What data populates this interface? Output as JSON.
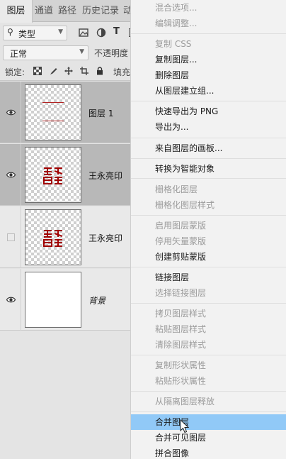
{
  "tabs": {
    "layers": "图层",
    "channels": "通道",
    "paths": "路径",
    "history": "历史记录",
    "more": "动"
  },
  "filter": {
    "kind_label": "类型"
  },
  "blend": {
    "mode": "正常",
    "opacity_label": "不透明度"
  },
  "lock": {
    "label": "锁定:",
    "fill_label": "填充"
  },
  "layers": [
    {
      "name": "图层 1",
      "visible": true,
      "selected": true
    },
    {
      "name": "王永亮印",
      "visible": true,
      "selected": true
    },
    {
      "name": "王永亮印",
      "visible": false,
      "selected": false
    },
    {
      "name": "背景",
      "visible": true,
      "selected": false
    }
  ],
  "menu": {
    "items": [
      {
        "label": "混合选项...",
        "enabled": false
      },
      {
        "label": "编辑调整...",
        "enabled": false
      },
      {
        "label": "复制 CSS",
        "enabled": false
      },
      {
        "label": "复制图层...",
        "enabled": true
      },
      {
        "label": "删除图层",
        "enabled": true
      },
      {
        "label": "从图层建立组...",
        "enabled": true
      },
      {
        "label": "快速导出为 PNG",
        "enabled": true
      },
      {
        "label": "导出为...",
        "enabled": true
      },
      {
        "label": "来自图层的画板...",
        "enabled": true
      },
      {
        "label": "转换为智能对象",
        "enabled": true
      },
      {
        "label": "栅格化图层",
        "enabled": false
      },
      {
        "label": "栅格化图层样式",
        "enabled": false
      },
      {
        "label": "启用图层蒙版",
        "enabled": false
      },
      {
        "label": "停用矢量蒙版",
        "enabled": false
      },
      {
        "label": "创建剪贴蒙版",
        "enabled": true
      },
      {
        "label": "链接图层",
        "enabled": true
      },
      {
        "label": "选择链接图层",
        "enabled": false
      },
      {
        "label": "拷贝图层样式",
        "enabled": false
      },
      {
        "label": "粘贴图层样式",
        "enabled": false
      },
      {
        "label": "清除图层样式",
        "enabled": false
      },
      {
        "label": "复制形状属性",
        "enabled": false
      },
      {
        "label": "粘贴形状属性",
        "enabled": false
      },
      {
        "label": "从隔离图层释放",
        "enabled": false
      },
      {
        "label": "合并图层",
        "enabled": true,
        "highlighted": true
      },
      {
        "label": "合并可见图层",
        "enabled": true
      },
      {
        "label": "拼合图像",
        "enabled": true
      }
    ]
  }
}
